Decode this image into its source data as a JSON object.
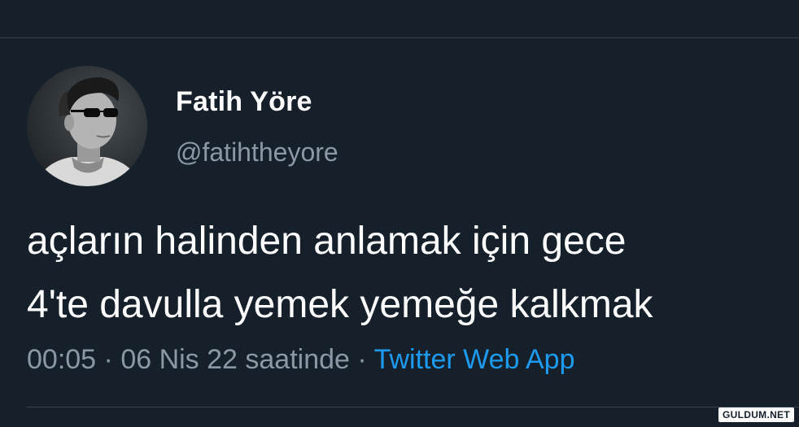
{
  "tweet": {
    "author": {
      "display_name": "Fatih Yöre",
      "handle": "@fatihtheyore"
    },
    "text_lines": [
      "açların halinden anlamak için gece",
      "4'te davulla yemek yemeğe kalkmak"
    ],
    "meta": {
      "time": "00:05",
      "separator": " · ",
      "date": "06 Nis 22 saatinde",
      "source": "Twitter Web App"
    }
  },
  "watermark": "GULDUM.NET",
  "colors": {
    "background": "#15202b",
    "text": "#ffffff",
    "muted": "#8b98a5",
    "link": "#1d9bf0",
    "divider": "#38444d"
  }
}
